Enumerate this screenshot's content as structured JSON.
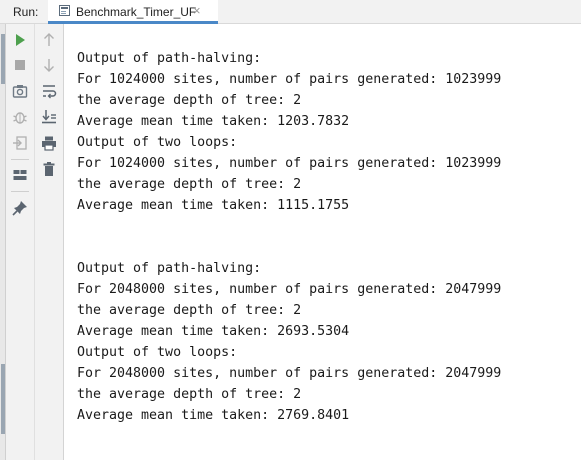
{
  "header": {
    "run_label": "Run:",
    "tab_label": "Benchmark_Timer_UF",
    "tab_close_glyph": "×"
  },
  "toolbar": {
    "left": [
      {
        "name": "rerun-icon",
        "color": "#4ea04e"
      },
      {
        "name": "stop-icon",
        "color": "#a8a8a8"
      },
      {
        "name": "camera-icon",
        "color": "#6f7a85"
      },
      {
        "name": "debug-icon",
        "color": "#b0b0b0"
      },
      {
        "name": "exit-icon",
        "color": "#b0b0b0"
      },
      {
        "name": "layout-icon",
        "color": "#5b6570"
      },
      {
        "name": "pin-icon",
        "color": "#5b6570"
      }
    ],
    "right": [
      {
        "name": "up-arrow-icon",
        "color": "#b0b0b0"
      },
      {
        "name": "down-arrow-icon",
        "color": "#b0b0b0"
      },
      {
        "name": "soft-wrap-icon",
        "color": "#5b6570"
      },
      {
        "name": "scroll-to-end-icon",
        "color": "#5b6570"
      },
      {
        "name": "print-icon",
        "color": "#5b6570"
      },
      {
        "name": "trash-icon",
        "color": "#5b6570"
      }
    ]
  },
  "console": {
    "lines": [
      "Output of path-halving:",
      "For 1024000 sites, number of pairs generated: 1023999",
      "the average depth of tree: 2",
      "Average mean time taken: 1203.7832",
      "Output of two loops:",
      "For 1024000 sites, number of pairs generated: 1023999",
      "the average depth of tree: 2",
      "Average mean time taken: 1115.1755",
      "",
      "",
      "Output of path-halving:",
      "For 2048000 sites, number of pairs generated: 2047999",
      "the average depth of tree: 2",
      "Average mean time taken: 2693.5304",
      "Output of two loops:",
      "For 2048000 sites, number of pairs generated: 2047999",
      "the average depth of tree: 2",
      "Average mean time taken: 2769.8401"
    ]
  },
  "colors": {
    "tab_underline": "#4a88c7",
    "run_green": "#4ea04e"
  }
}
